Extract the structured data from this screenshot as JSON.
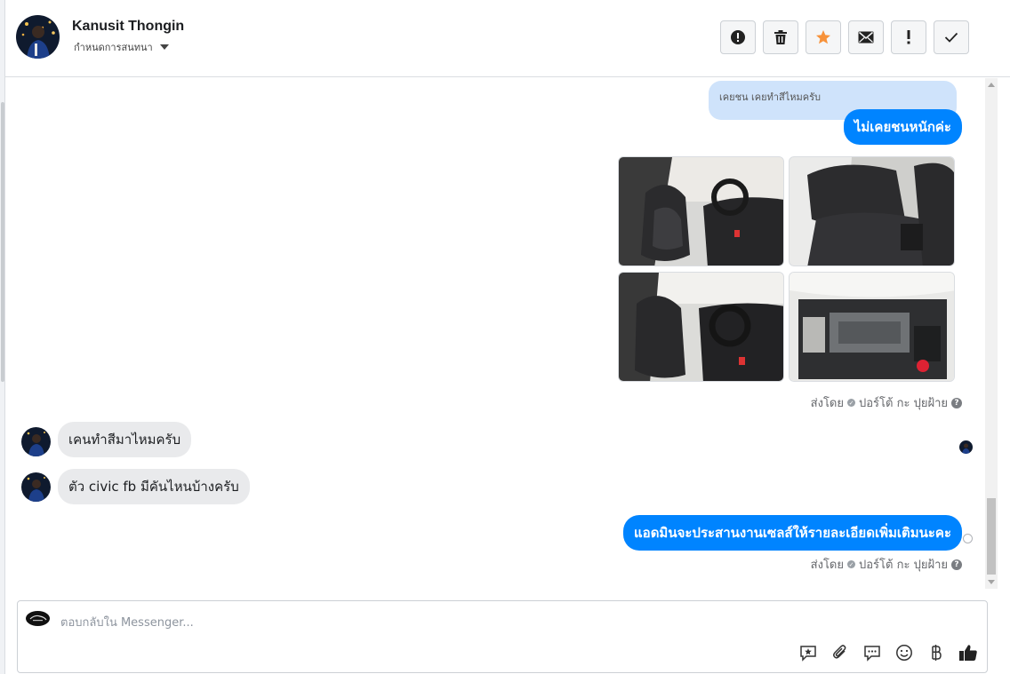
{
  "header": {
    "user_name": "Kanusit Thongin",
    "assign_label": "กำหนดการสนทนา",
    "toolbar": [
      {
        "name": "spam-icon",
        "label": "spam"
      },
      {
        "name": "trash-icon",
        "label": "delete"
      },
      {
        "name": "star-icon",
        "label": "star",
        "color": "#f7923a"
      },
      {
        "name": "mail-icon",
        "label": "mark unread"
      },
      {
        "name": "exclamation-icon",
        "label": "follow up"
      },
      {
        "name": "check-icon",
        "label": "done"
      }
    ]
  },
  "messages": {
    "quote_text": "เคยชน เคยทำสีไหมครับ",
    "reply_1": "ไม่เคยชนหนักค่ะ",
    "sent_by_1": "ส่งโดย",
    "sent_by_name_1": "ปอร์โต้ กะ ปุยฝ้าย",
    "incoming_1": "เคนทำสีมาไหมครับ",
    "incoming_2": "ตัว civic fb มีคันไหนบ้างครับ",
    "reply_2": "แอดมินจะประสานงานเซลส์ให้รายละเอียดเพิ่มเติมนะคะ",
    "sent_by_2": "ส่งโดย",
    "sent_by_name_2": "ปอร์โต้ กะ ปุยฝ้าย",
    "photos": [
      "car-front-seats-photo",
      "car-rear-seats-photo",
      "car-dashboard-photo",
      "car-engine-photo"
    ]
  },
  "composer": {
    "placeholder": "ตอบกลับใน Messenger...",
    "icons": [
      "saved-reply-icon",
      "attachment-icon",
      "chat-icon",
      "emoji-icon",
      "baht-icon",
      "thumbs-up-icon"
    ]
  },
  "colors": {
    "accent": "#0084ff",
    "quote_bg": "#cfe3fb",
    "incoming_bg": "#e9eaec"
  }
}
